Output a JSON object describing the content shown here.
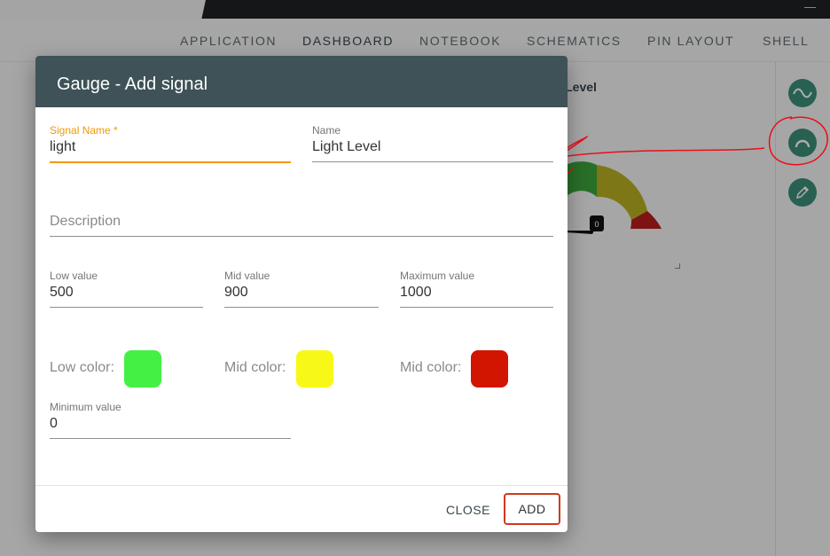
{
  "navbar": {
    "tabs": [
      "APPLICATION",
      "DASHBOARD",
      "NOTEBOOK",
      "SCHEMATICS",
      "PIN LAYOUT",
      "SHELL"
    ],
    "active_tab": "DASHBOARD"
  },
  "widget": {
    "title_visible": "nt Level",
    "gauge_value": "0"
  },
  "sidebar": {
    "buttons": [
      "wave-icon",
      "gauge-icon",
      "pencil-icon"
    ]
  },
  "dialog": {
    "title": "Gauge - Add signal",
    "signal_name": {
      "label": "Signal Name *",
      "value": "light"
    },
    "name": {
      "label": "Name",
      "value": "Light Level"
    },
    "description": {
      "placeholder": "Description",
      "value": ""
    },
    "low_value": {
      "label": "Low value",
      "value": "500"
    },
    "mid_value": {
      "label": "Mid value",
      "value": "900"
    },
    "max_value": {
      "label": "Maximum value",
      "value": "1000"
    },
    "low_color": {
      "label": "Low color:",
      "color": "#44f044"
    },
    "mid_color": {
      "label": "Mid color:",
      "color": "#f8f817"
    },
    "high_color": {
      "label": "Mid color:",
      "color": "#d11500"
    },
    "min_value": {
      "label": "Minimum value",
      "value": "0"
    },
    "close_label": "CLOSE",
    "add_label": "ADD"
  },
  "colors": {
    "header": "#3e5258",
    "accent": "#f29a00",
    "sidebar_button": "#3b8e7a",
    "annotation": "#e8101a"
  }
}
